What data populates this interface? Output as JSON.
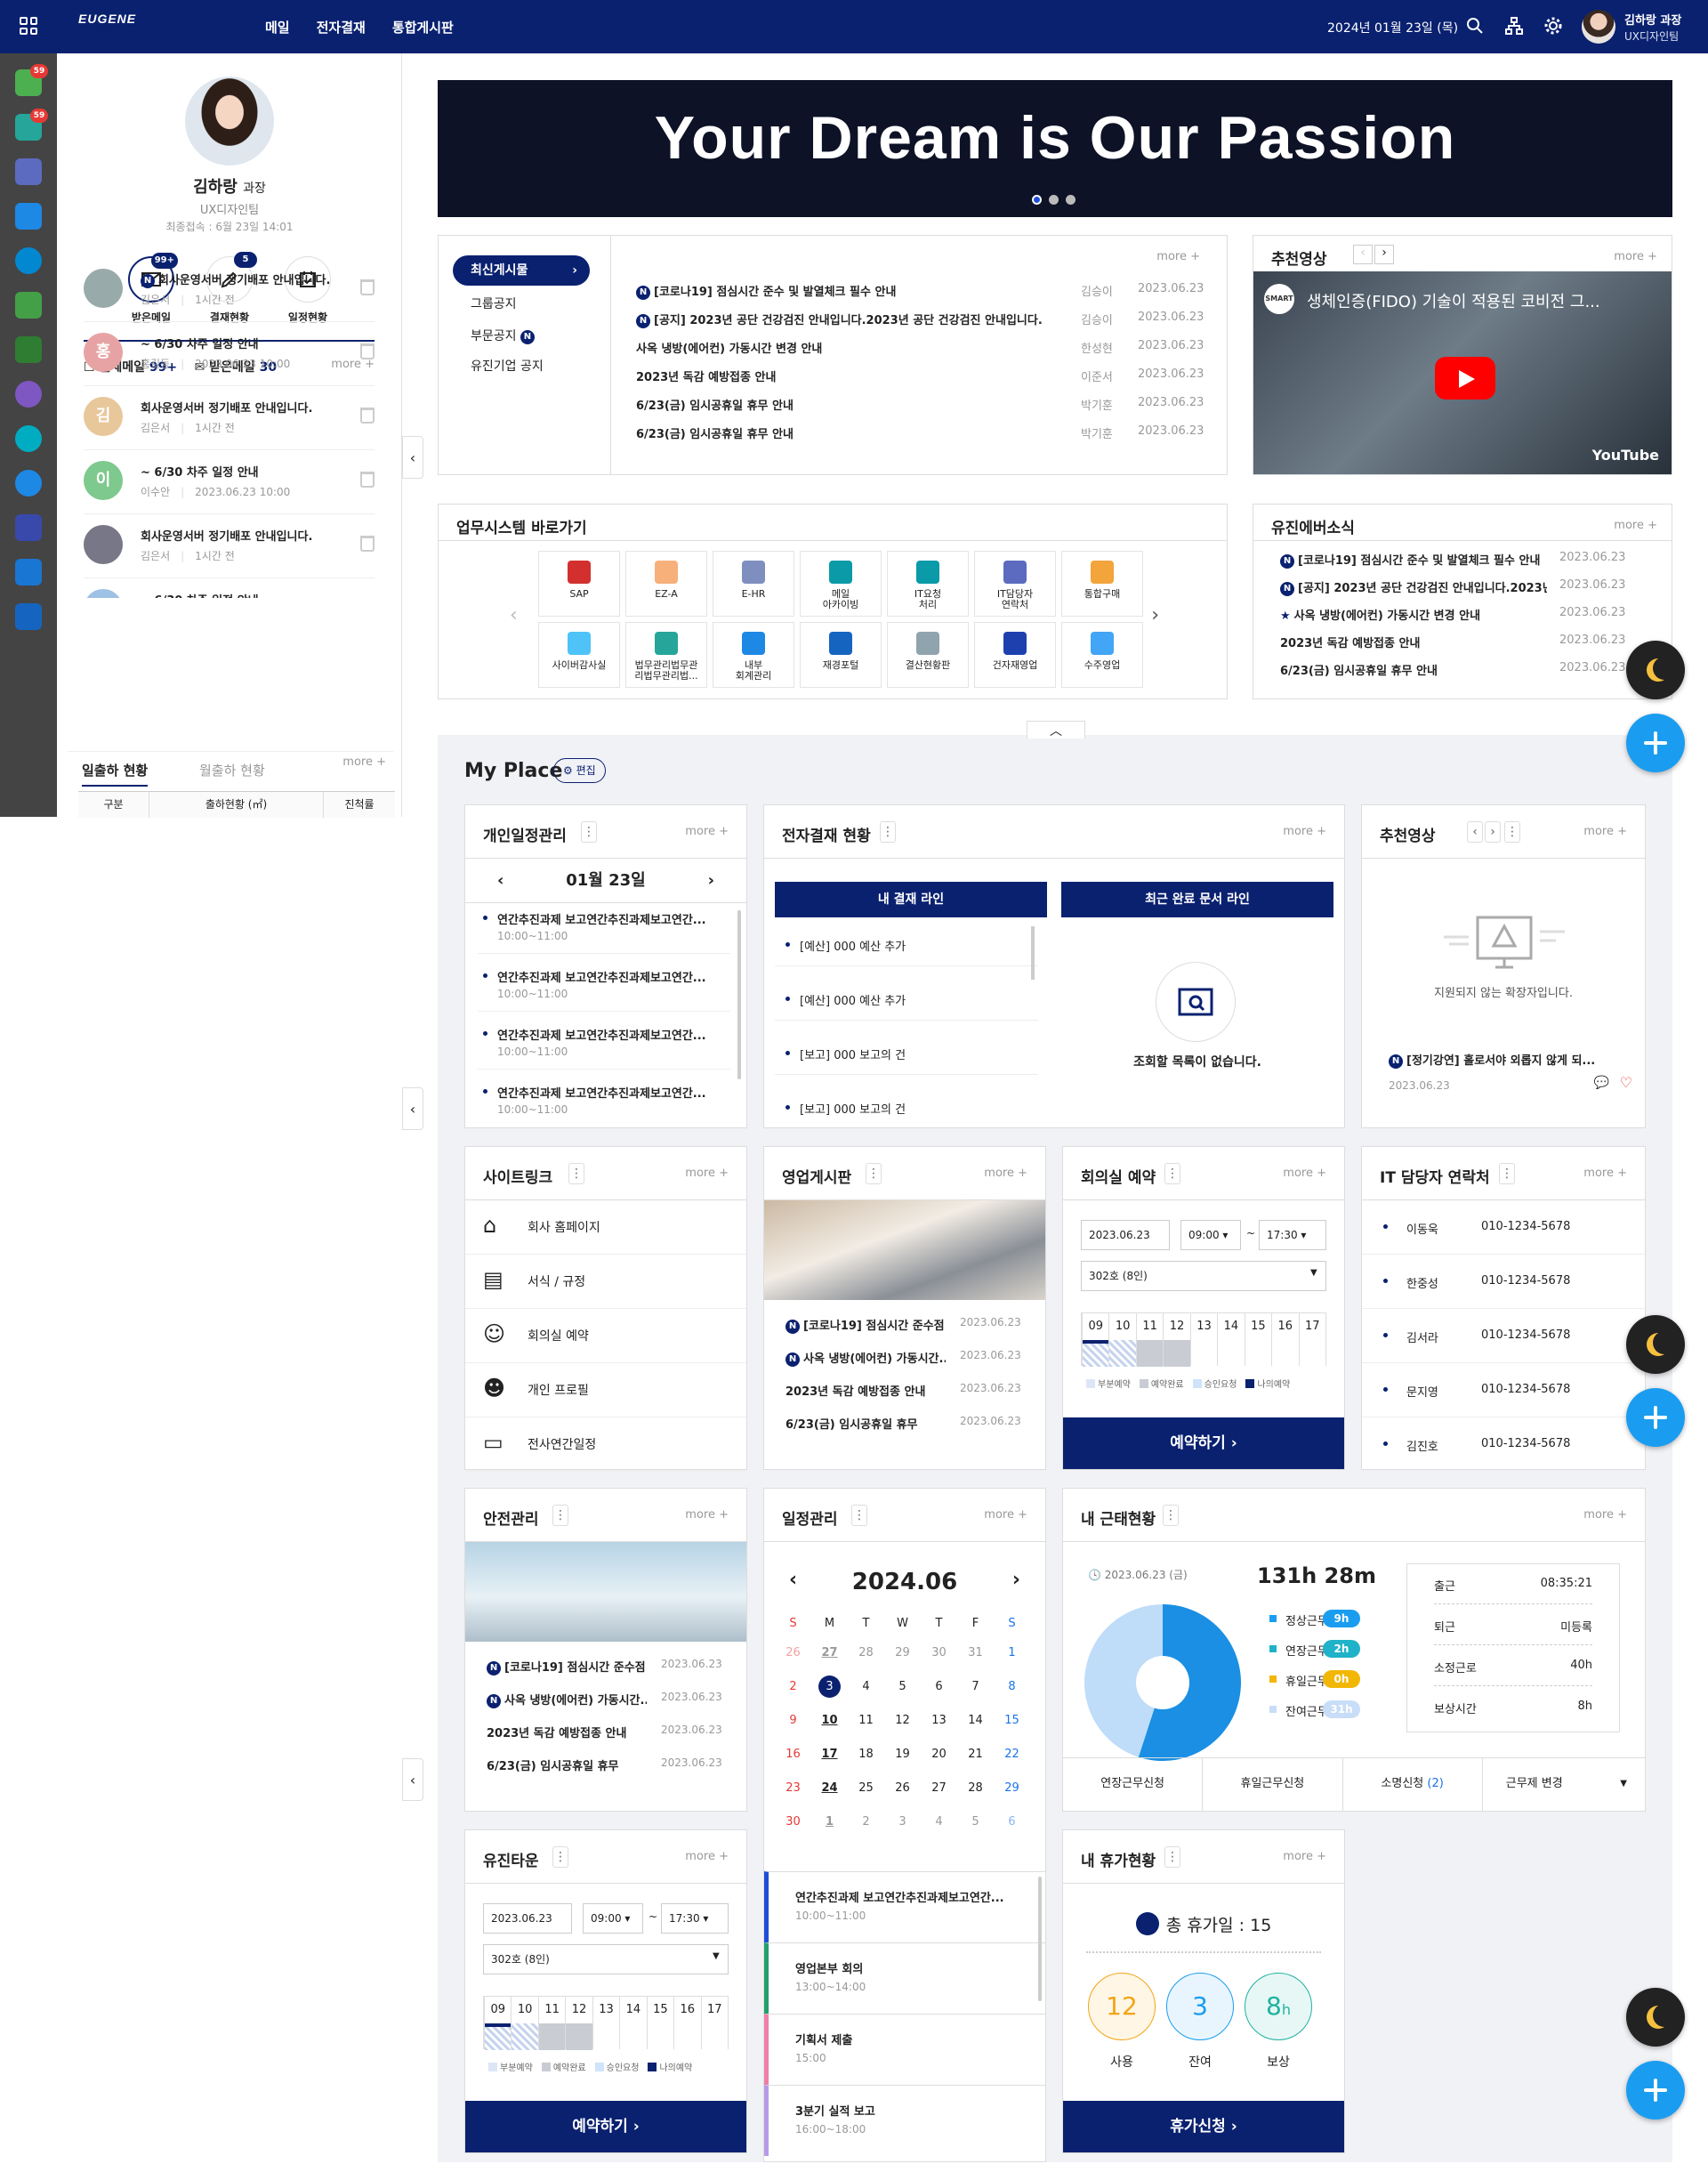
{
  "header": {
    "logo": "EUGENE",
    "nav": [
      "메일",
      "전자결재",
      "통합게시판"
    ],
    "date": "2024년 01월 23일 (목)",
    "user_name": "김하랑 과장",
    "user_dept": "UX디자인팀"
  },
  "rail": {
    "badges": [
      "59",
      "59"
    ]
  },
  "profile": {
    "name": "김하랑",
    "title": "과장",
    "dept": "UX디자인팀",
    "last_login": "최종접속 : 6월 23일 14:01",
    "quick": [
      {
        "label": "받은메일",
        "badge": "99+"
      },
      {
        "label": "결재현황",
        "badge": "5"
      },
      {
        "label": "일정현황",
        "badge": ""
      }
    ]
  },
  "mail": {
    "total_label": "전체메일",
    "total": "99+",
    "inbox_label": "받은메일",
    "inbox": "30",
    "more": "more",
    "items": [
      {
        "title": "회사운영서버 정기배포 안내입니다.",
        "from": "김은서",
        "time": "1시간 전",
        "avatar": "",
        "n": true,
        "color": "#9aa"
      },
      {
        "title": "~ 6/30 차주 일정 안내",
        "from": "홍길동",
        "time": "2023.06.23 10:00",
        "avatar": "홍",
        "n": false,
        "color": "#e7a3a3"
      },
      {
        "title": "회사운영서버 정기배포 안내입니다.",
        "from": "김은서",
        "time": "1시간 전",
        "avatar": "김",
        "n": false,
        "color": "#e8c79b"
      },
      {
        "title": "~ 6/30 차주 일정 안내",
        "from": "이수안",
        "time": "2023.06.23 10:00",
        "avatar": "이",
        "n": false,
        "color": "#7ec98d"
      },
      {
        "title": "회사운영서버 정기배포 안내입니다.",
        "from": "김은서",
        "time": "1시간 전",
        "avatar": "",
        "n": false,
        "color": "#778"
      }
    ],
    "partial": "~ 6/30 차주 일정 안내"
  },
  "attendance": {
    "tabs": [
      "일출하 현황",
      "월출하 현황"
    ],
    "more": "more",
    "cols": [
      "구분",
      "출하현황 (㎡)",
      "진척률"
    ]
  },
  "banner": {
    "title": "Your Dream is Our Passion"
  },
  "board": {
    "tabs": [
      "최신게시물",
      "그룹공지",
      "부문공지",
      "유진기업 공지"
    ],
    "more": "more",
    "rows": [
      {
        "n": true,
        "t": "[코로나19] 점심시간 준수 및 발열체크 필수 안내",
        "a": "김승이",
        "d": "2023.06.23"
      },
      {
        "n": true,
        "t": "[공지] 2023년 공단 건강검진 안내입니다.2023년 공단 건강검진 안내입니다.",
        "a": "김승이",
        "d": "2023.06.23"
      },
      {
        "n": false,
        "t": "사옥 냉방(에어컨) 가동시간 변경 안내",
        "a": "한성현",
        "d": "2023.06.23"
      },
      {
        "n": false,
        "t": "2023년 독감 예방접종 안내",
        "a": "이준서",
        "d": "2023.06.23"
      },
      {
        "n": false,
        "t": "6/23(금) 임시공휴일 휴무 안내",
        "a": "박기훈",
        "d": "2023.06.23"
      },
      {
        "n": false,
        "t": "6/23(금) 임시공휴일 휴무 안내",
        "a": "박기훈",
        "d": "2023.06.23"
      }
    ]
  },
  "video": {
    "title": "추천영상",
    "more": "more",
    "caption": "생체인증(FIDO) 기술이 적용된 코비전 그...",
    "yt": "YouTube",
    "smart": "SMART"
  },
  "systems": {
    "title": "업무시스템 바로가기",
    "items": [
      "SAP",
      "EZ-A",
      "E-HR",
      "메일\n아카이빙",
      "IT요청\n처리",
      "IT담당자\n연락처",
      "통합구매",
      "사이버감사실",
      "법무관리법무관\n리법무관리법...",
      "내부\n회계관리",
      "재경포털",
      "결산현황판",
      "건자재영업",
      "수주영업"
    ]
  },
  "yujin_news": {
    "title": "유진에버소식",
    "more": "more",
    "rows": [
      {
        "ic": "n",
        "t": "[코로나19] 점심시간 준수 및 발열체크 필수 안내",
        "d": "2023.06.23"
      },
      {
        "ic": "n",
        "t": "[공지] 2023년 공단 건강검진 안내입니다.2023년...",
        "d": "2023.06.23"
      },
      {
        "ic": "star",
        "t": "사옥 냉방(에어컨) 가동시간 변경 안내",
        "d": "2023.06.23"
      },
      {
        "ic": "",
        "t": "2023년 독감 예방접종 안내",
        "d": "2023.06.23"
      },
      {
        "ic": "",
        "t": "6/23(금) 임시공휴일 휴무 안내",
        "d": "2023.06.23"
      }
    ]
  },
  "myplace": {
    "title": "My Place",
    "edit": "편집"
  },
  "schedule": {
    "title": "개인일정관리",
    "more": "more",
    "date": "01월 23일",
    "items": [
      {
        "t": "연간추진과제 보고연간추진과제보고연간...",
        "time": "10:00~11:00"
      },
      {
        "t": "연간추진과제 보고연간추진과제보고연간...",
        "time": "10:00~11:00"
      },
      {
        "t": "연간추진과제 보고연간추진과제보고연간...",
        "time": "10:00~11:00"
      },
      {
        "t": "연간추진과제 보고연간추진과제보고연간...",
        "time": "10:00~11:00"
      }
    ]
  },
  "approval": {
    "title": "전자결재 현황",
    "more": "more",
    "tab1": "내 결재 라인",
    "tab2": "최근 완료 문서 라인",
    "items": [
      "[예산] 000 예산 추가",
      "[예산] 000 예산 추가",
      "[보고] 000 보고의 건",
      "[보고] 000 보고의 건"
    ],
    "empty": "조회할 목록이 없습니다."
  },
  "rec_video": {
    "title": "추천영상",
    "more": "more",
    "unsupported": "지원되지 않는 확장자입니다.",
    "caption": "[정기강연] 홀로서야 외롭지 않게 되...",
    "date": "2023.06.23"
  },
  "sitelinks": {
    "title": "사이트링크",
    "more": "more",
    "items": [
      "회사 홈페이지",
      "서식 / 규정",
      "회의실 예약",
      "개인 프로필",
      "전사연간일정"
    ]
  },
  "sales_board": {
    "title": "영업게시판",
    "more": "more",
    "rows": [
      {
        "n": true,
        "t": "[코로나19] 점심시간 준수점...",
        "d": "2023.06.23"
      },
      {
        "n": true,
        "t": "사옥 냉방(에어컨) 가동시간...",
        "d": "2023.06.23"
      },
      {
        "n": false,
        "t": "2023년 독감 예방접종 안내",
        "d": "2023.06.23"
      },
      {
        "n": false,
        "t": "6/23(금) 임시공휴일 휴무",
        "d": "2023.06.23"
      }
    ]
  },
  "meeting": {
    "title": "회의실 예약",
    "more": "more",
    "date": "2023.06.23",
    "start": "09:00",
    "end": "17:30",
    "room": "302호 (8인)",
    "hours": [
      "09",
      "10",
      "11",
      "12",
      "13",
      "14",
      "15",
      "16",
      "17"
    ],
    "legend": [
      "부분예약",
      "예약완료",
      "승인요청",
      "나의예약"
    ],
    "btn": "예약하기"
  },
  "it_contact": {
    "title": "IT 담당자 연락처",
    "more": "more",
    "rows": [
      {
        "n": "이동욱",
        "p": "010-1234-5678"
      },
      {
        "n": "한중성",
        "p": "010-1234-5678"
      },
      {
        "n": "김서라",
        "p": "010-1234-5678"
      },
      {
        "n": "문지영",
        "p": "010-1234-5678"
      },
      {
        "n": "김진호",
        "p": "010-1234-5678"
      }
    ]
  },
  "safety": {
    "title": "안전관리",
    "more": "more",
    "rows": [
      {
        "n": true,
        "t": "[코로나19] 점심시간 준수점...",
        "d": "2023.06.23"
      },
      {
        "n": true,
        "t": "사옥 냉방(에어컨) 가동시간...",
        "d": "2023.06.23"
      },
      {
        "n": false,
        "t": "2023년 독감 예방접종 안내",
        "d": "2023.06.23"
      },
      {
        "n": false,
        "t": "6/23(금) 임시공휴일 휴무",
        "d": "2023.06.23"
      }
    ]
  },
  "calendar": {
    "title": "일정관리",
    "more": "more",
    "month": "2024.06",
    "dow": [
      "S",
      "M",
      "T",
      "W",
      "T",
      "F",
      "S"
    ],
    "weeks": [
      [
        "26",
        "27",
        "28",
        "29",
        "30",
        "31",
        "1"
      ],
      [
        "2",
        "3",
        "4",
        "5",
        "6",
        "7",
        "8"
      ],
      [
        "9",
        "10",
        "11",
        "12",
        "13",
        "14",
        "15"
      ],
      [
        "16",
        "17",
        "18",
        "19",
        "20",
        "21",
        "22"
      ],
      [
        "23",
        "24",
        "25",
        "26",
        "27",
        "28",
        "29"
      ],
      [
        "30",
        "1",
        "2",
        "3",
        "4",
        "5",
        "6"
      ]
    ],
    "events": [
      {
        "t": "연간추진과제 보고연간추진과제보고연간...",
        "time": "10:00~11:00",
        "c": "#1d4ed8"
      },
      {
        "t": "영업본부 회의",
        "time": "13:00~14:00",
        "c": "#22a06b"
      },
      {
        "t": "기획서 제출",
        "time": "15:00",
        "c": "#ef7fa6"
      },
      {
        "t": "3분기 실적 보고",
        "time": "16:00~18:00",
        "c": "#b79be6"
      }
    ]
  },
  "worktime": {
    "title": "내 근태현황",
    "more": "more",
    "date": "2023.06.23 (금)",
    "total": "131h 28m",
    "legend": [
      {
        "l": "정상근무",
        "v": "9h",
        "c": "#1a9df0"
      },
      {
        "l": "연장근무",
        "v": "2h",
        "c": "#20b2c8"
      },
      {
        "l": "휴일근무",
        "v": "0h",
        "c": "#f2b705"
      },
      {
        "l": "잔여근무",
        "v": "31h",
        "c": "#c8ddf7"
      }
    ],
    "pie": [
      {
        "v": 0.55,
        "c": "#1a8fe3"
      },
      {
        "v": 0.45,
        "c": "#bfdcf9"
      }
    ],
    "stats": [
      {
        "l": "출근",
        "v": "08:35:21"
      },
      {
        "l": "퇴근",
        "v": "미등록"
      },
      {
        "l": "소정근로",
        "v": "40h"
      },
      {
        "l": "보상시간",
        "v": "8h"
      }
    ],
    "actions": [
      "연장근무신청",
      "휴일근무신청",
      "소명신청",
      "(2)",
      "근무제 변경"
    ]
  },
  "yujintown": {
    "title": "유진타운",
    "more": "more",
    "date": "2023.06.23",
    "start": "09:00",
    "end": "17:30",
    "room": "302호 (8인)",
    "hours": [
      "09",
      "10",
      "11",
      "12",
      "13",
      "14",
      "15",
      "16",
      "17"
    ],
    "legend": [
      "부분예약",
      "예약완료",
      "승인요청",
      "나의예약"
    ],
    "btn": "예약하기"
  },
  "leave": {
    "title": "내 휴가현황",
    "more": "more",
    "total": "총 휴가일 : 15",
    "items": [
      {
        "v": "12",
        "l": "사용",
        "c": "#f2a516",
        "bg": "#fff6e5"
      },
      {
        "v": "3",
        "l": "잔여",
        "c": "#1a9df0",
        "bg": "#e9f5fe"
      },
      {
        "v": "8",
        "u": "h",
        "l": "보상",
        "c": "#20b2a0",
        "bg": "#e6f7f5"
      }
    ],
    "btn": "휴가신청"
  }
}
